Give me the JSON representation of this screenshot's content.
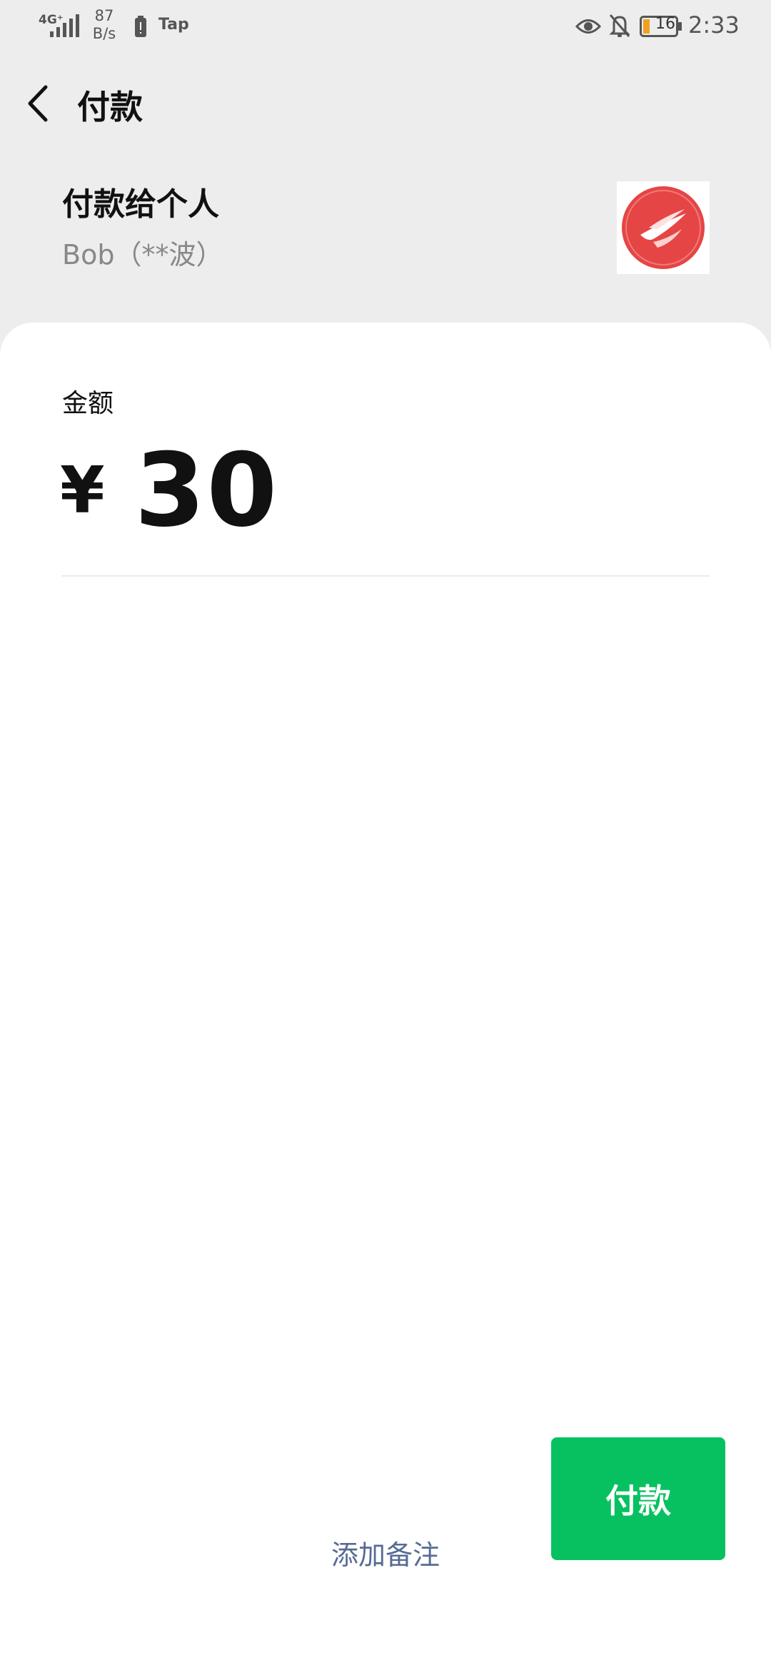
{
  "status_bar": {
    "network": "4G⁺",
    "speed_value": "87",
    "speed_unit": "B/s",
    "tap_label": "Tap",
    "battery_level": "16",
    "time": "2:33"
  },
  "nav": {
    "title": "付款"
  },
  "payee": {
    "title": "付款给个人",
    "name": "Bob（**波）"
  },
  "amount": {
    "label": "金额",
    "currency_symbol": "¥",
    "value": "30"
  },
  "actions": {
    "pay_label": "付款",
    "add_note_label": "添加备注"
  },
  "colors": {
    "accent_green": "#07c160",
    "link_blue": "#576b95",
    "background": "#ededed"
  },
  "icons": {
    "back": "chevron-left-icon",
    "eye": "eye-icon",
    "bell_off": "bell-off-icon",
    "avatar": "bird-logo-icon"
  }
}
